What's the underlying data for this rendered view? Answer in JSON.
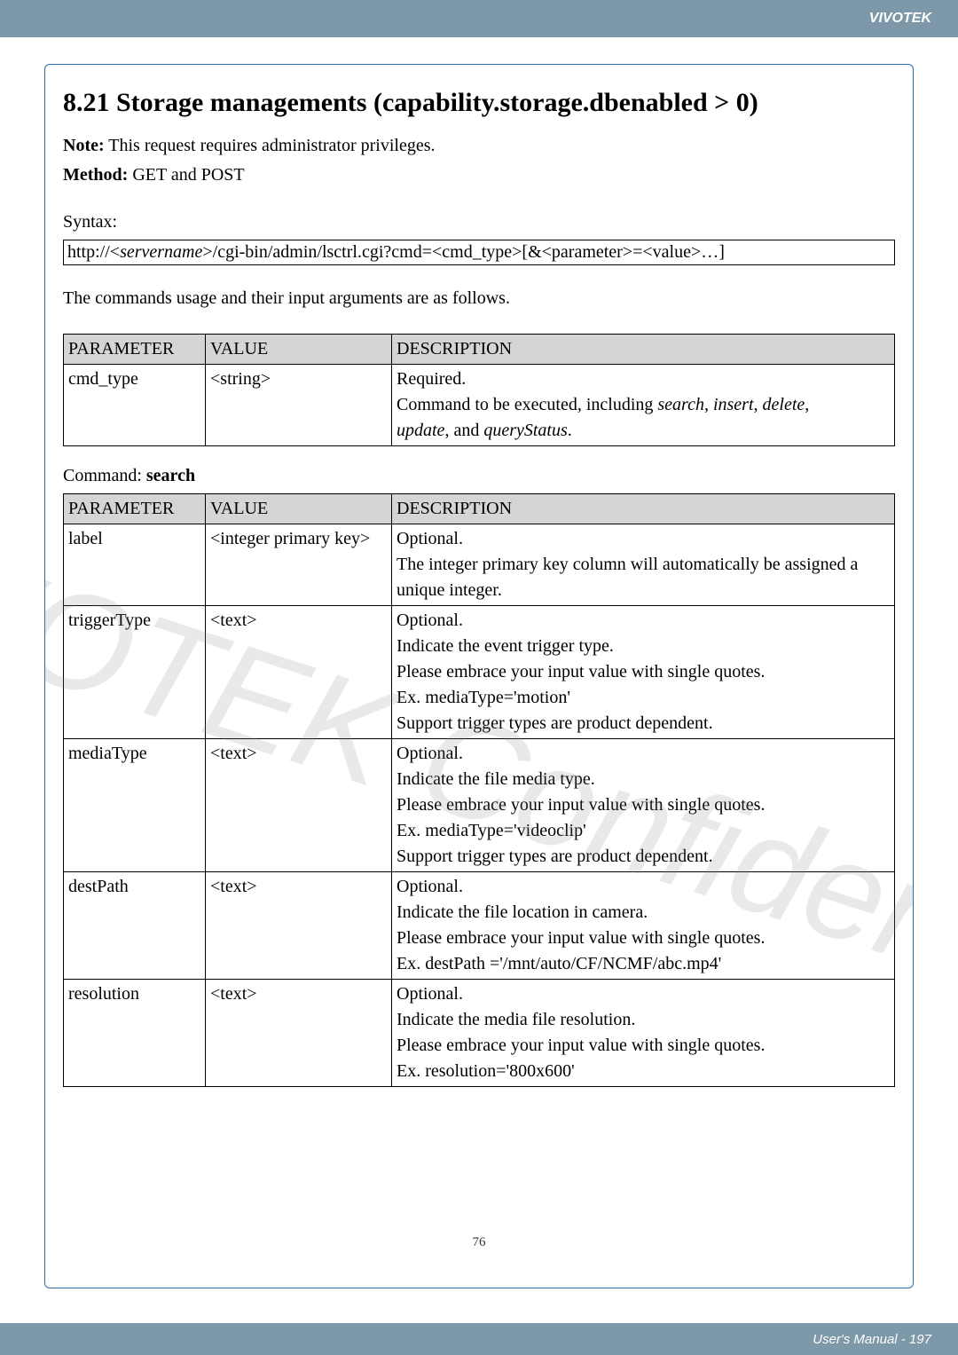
{
  "header": {
    "brand": "VIVOTEK"
  },
  "section": {
    "title": "8.21 Storage managements (capability.storage.dbenabled > 0)",
    "note_label": "Note:",
    "note_text": " This request requires administrator privileges.",
    "method_label": "Method:",
    "method_text": " GET and POST",
    "syntax_label": "Syntax:",
    "syntax_text_prefix": "http://<",
    "syntax_text_server": "servername",
    "syntax_text_suffix": ">/cgi-bin/admin/lsctrl.cgi?cmd=<cmd_type>[&<parameter>=<value>…]",
    "cmds_usage": "The commands usage and their input arguments are as follows."
  },
  "table1": {
    "headers": [
      "PARAMETER",
      "VALUE",
      "DESCRIPTION"
    ],
    "rows": [
      {
        "param": "cmd_type",
        "value": "<string>",
        "desc_lines": [
          {
            "plain": "Required."
          },
          {
            "prefix": "Command to be executed, including ",
            "italic": "search",
            "mid": ", ",
            "italic2": "insert",
            "mid2": ", ",
            "italic3": "delete",
            "mid3": ", "
          },
          {
            "italic": "update",
            "mid": ", and ",
            "italic2": "queryStatus",
            "suffix": "."
          }
        ]
      }
    ]
  },
  "command_label_prefix": "Command: ",
  "command_label_bold": "search",
  "table2": {
    "headers": [
      "PARAMETER",
      "VALUE",
      "DESCRIPTION"
    ],
    "rows": [
      {
        "param": "label",
        "value": "<integer primary key>",
        "desc": "Optional.\nThe integer primary key column will automatically be assigned a unique integer."
      },
      {
        "param": "triggerType",
        "value": "<text>",
        "desc": "Optional.\nIndicate the event trigger type.\nPlease embrace your input value with single quotes.\nEx. mediaType='motion'\nSupport trigger types are product dependent."
      },
      {
        "param": "mediaType",
        "value": "<text>",
        "desc": "Optional.\nIndicate the file media type.\nPlease embrace your input value with single quotes.\nEx. mediaType='videoclip'\nSupport trigger types are product dependent."
      },
      {
        "param": "destPath",
        "value": "<text>",
        "desc": "Optional.\nIndicate the file location in camera.\nPlease embrace your input value with single quotes.\nEx. destPath ='/mnt/auto/CF/NCMF/abc.mp4'"
      },
      {
        "param": "resolution",
        "value": "<text>",
        "desc": "Optional.\nIndicate the media file resolution.\nPlease embrace your input value with single quotes.\nEx. resolution='800x600'"
      }
    ]
  },
  "footer": {
    "inner_page": "76",
    "manual": "User's Manual - 197"
  }
}
